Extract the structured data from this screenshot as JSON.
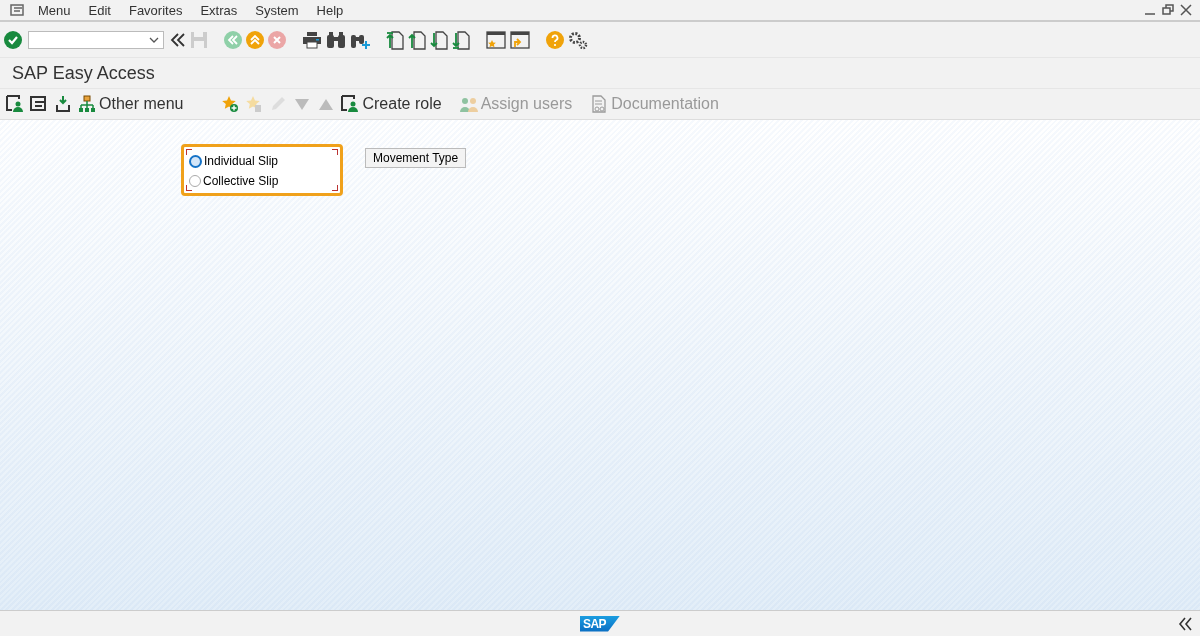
{
  "menu_bar": {
    "items": [
      "Menu",
      "Edit",
      "Favorites",
      "Extras",
      "System",
      "Help"
    ]
  },
  "title": "SAP Easy Access",
  "app_toolbar": [
    {
      "label": "Other menu",
      "disabled": false
    },
    {
      "label": "Create role",
      "disabled": false
    },
    {
      "label": "Assign users",
      "disabled": true
    },
    {
      "label": "Documentation",
      "disabled": true
    }
  ],
  "radio_group": {
    "focused": true,
    "options": [
      {
        "label": "Individual Slip",
        "focused": true
      },
      {
        "label": "Collective Slip",
        "focused": false
      }
    ]
  },
  "movement_button": "Movement Type",
  "status_bar": {
    "logo": "SAP"
  }
}
